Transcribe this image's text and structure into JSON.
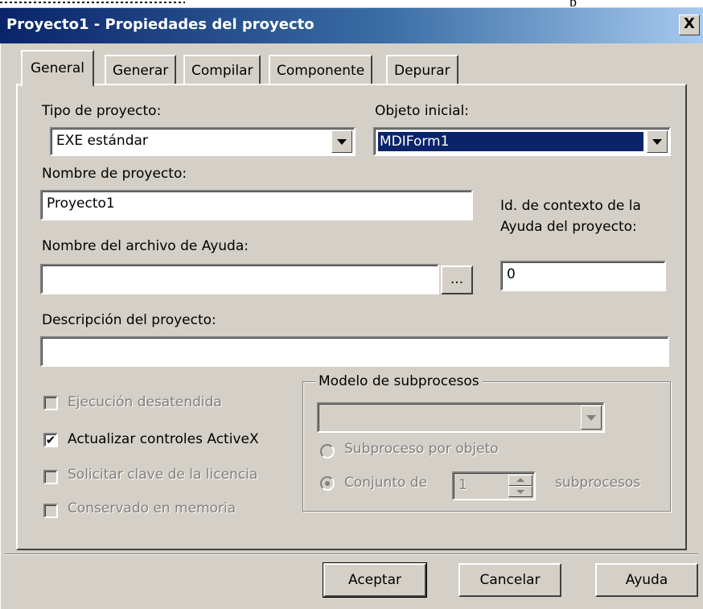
{
  "dialog": {
    "title": "Proyecto1 - Propiedades del proyecto",
    "close_glyph": "X"
  },
  "tabs": [
    {
      "label": "General",
      "active": true
    },
    {
      "label": "Generar",
      "active": false
    },
    {
      "label": "Compilar",
      "active": false
    },
    {
      "label": "Componente",
      "active": false
    },
    {
      "label": "Depurar",
      "active": false
    }
  ],
  "general": {
    "project_type_label": "Tipo de proyecto:",
    "project_type_value": "EXE estándar",
    "startup_object_label": "Objeto inicial:",
    "startup_object_value": "MDIForm1",
    "project_name_label": "Nombre de proyecto:",
    "project_name_value": "Proyecto1",
    "help_context_label_line1": "Id. de contexto de la",
    "help_context_label_line2": "Ayuda del proyecto:",
    "help_context_value": "0",
    "help_file_label": "Nombre del archivo de Ayuda:",
    "help_file_value": "",
    "browse_label": "...",
    "description_label": "Descripción del proyecto:",
    "description_value": ""
  },
  "options": {
    "unattended": {
      "label": "Ejecución desatendida",
      "checked": false,
      "enabled": false
    },
    "upgrade_activex": {
      "label": "Actualizar controles ActiveX",
      "checked": true,
      "enabled": true,
      "check_glyph": "✔"
    },
    "license_key": {
      "label": "Solicitar clave de la licencia",
      "checked": false,
      "enabled": false
    },
    "retained": {
      "label": "Conservado en memoria",
      "checked": false,
      "enabled": false
    }
  },
  "threading": {
    "group_title": "Modelo de subprocesos",
    "model_value": "",
    "per_object_label": "Subproceso por objeto",
    "pool_label": "Conjunto de",
    "pool_value": "1",
    "pool_suffix": "subprocesos"
  },
  "buttons": {
    "ok": "Aceptar",
    "cancel": "Cancelar",
    "help": "Ayuda"
  },
  "background": {
    "stray_text": "p"
  },
  "colors": {
    "title_bar_start": "#0a246a",
    "title_bar_end": "#a6caf0",
    "dialog_face": "#d4d0c8",
    "selection": "#0a246a"
  }
}
